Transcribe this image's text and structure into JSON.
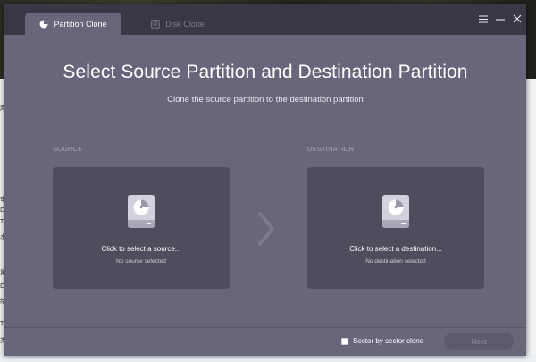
{
  "tabs": [
    {
      "label": "Partition Clone",
      "icon": "pie-chart-icon",
      "active": true
    },
    {
      "label": "Disk Clone",
      "icon": "disk-icon",
      "active": false
    }
  ],
  "window_controls": {
    "menu": "menu-icon",
    "minimize": "minimize-icon",
    "close": "close-icon"
  },
  "heading": {
    "title": "Select Source Partition and Destination Partition",
    "subtitle": "Clone the source partition to the destination partition"
  },
  "source": {
    "label": "SOURCE",
    "prompt": "Click to select a source...",
    "status": "No source selected"
  },
  "destination": {
    "label": "DESTINATION",
    "prompt": "Click to select a destination...",
    "status": "No destination selected"
  },
  "footer": {
    "sector_option": "Sector by sector clone",
    "sector_checked": false,
    "next_label": "Next",
    "next_enabled": false
  },
  "colors": {
    "window_bg": "#67667a",
    "titlebar_bg": "#393846",
    "panel_bg": "#4e4d5d",
    "drive_accent": "#c5c4d4"
  },
  "desktop_fragments": [
    "库",
    "审",
    "D",
    "T",
    "水",
    "第",
    "D",
    "给",
    "T",
    "类"
  ]
}
